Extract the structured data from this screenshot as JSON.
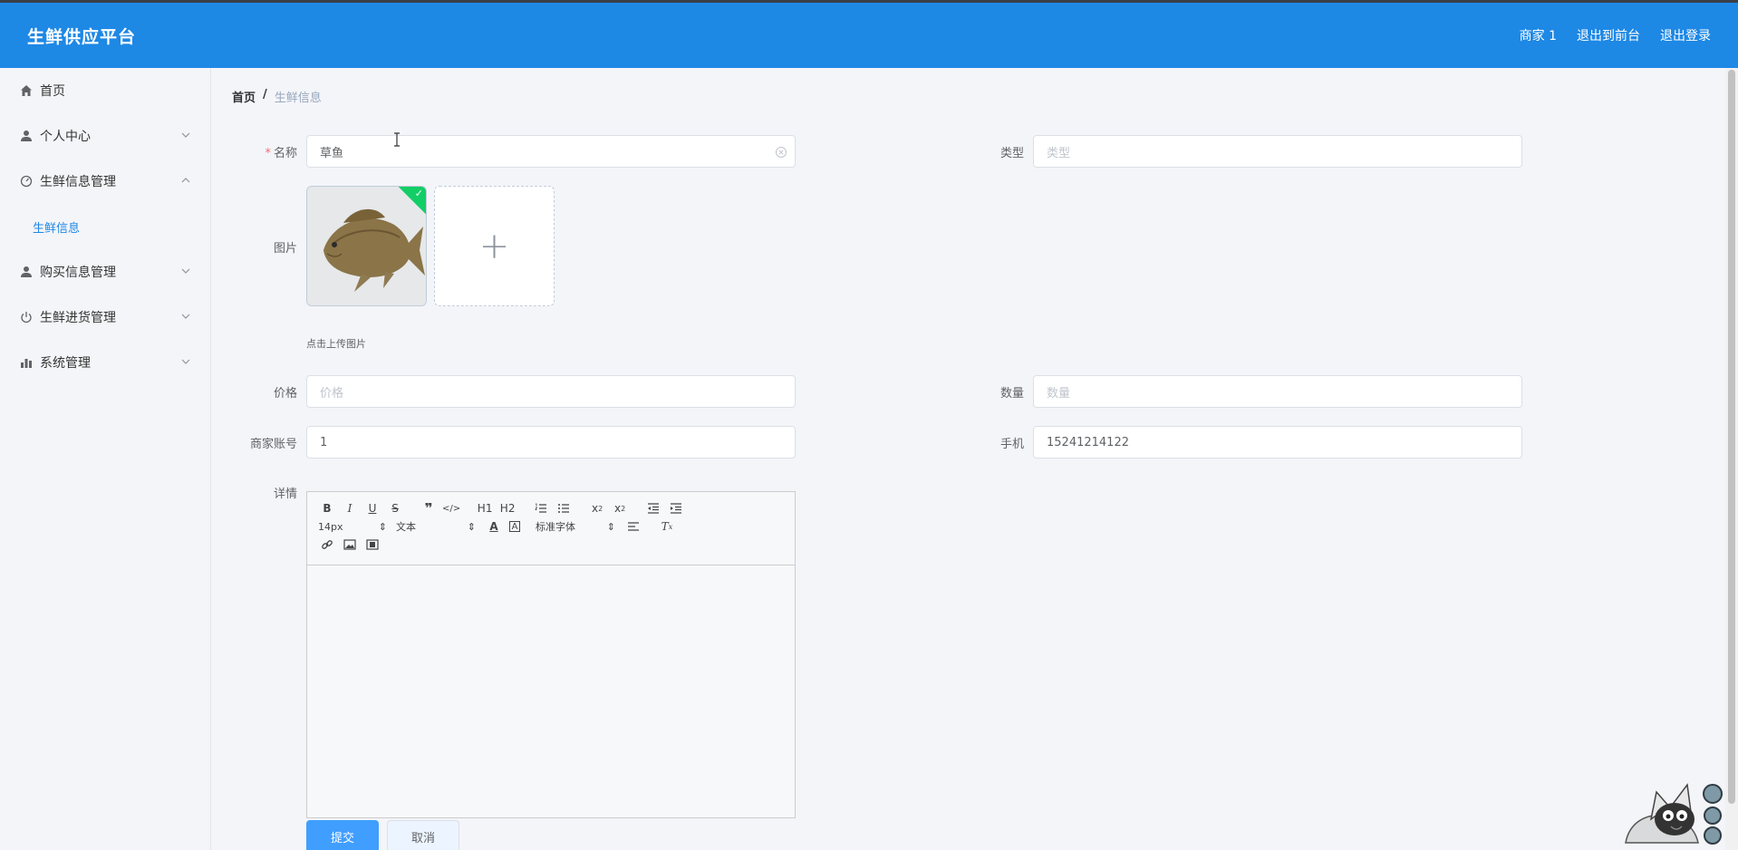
{
  "header": {
    "brand": "生鲜供应平台",
    "user": "商家 1",
    "back_to_front": "退出到前台",
    "logout": "退出登录"
  },
  "sidebar": {
    "items": [
      {
        "label": "首页",
        "icon": "home-icon"
      },
      {
        "label": "个人中心",
        "icon": "user-icon"
      },
      {
        "label": "生鲜信息管理",
        "icon": "dashboard-icon"
      },
      {
        "label": "生鲜信息",
        "icon": ""
      },
      {
        "label": "购买信息管理",
        "icon": "user-icon"
      },
      {
        "label": "生鲜进货管理",
        "icon": "power-icon"
      },
      {
        "label": "系统管理",
        "icon": "bar-chart-icon"
      }
    ]
  },
  "breadcrumb": {
    "home": "首页",
    "separator": "/",
    "current": "生鲜信息"
  },
  "form": {
    "name_label": "名称",
    "name_value": "草鱼",
    "type_label": "类型",
    "type_placeholder": "类型",
    "image_label": "图片",
    "upload_tip": "点击上传图片",
    "price_label": "价格",
    "price_placeholder": "价格",
    "quantity_label": "数量",
    "quantity_placeholder": "数量",
    "merchant_label": "商家账号",
    "merchant_value": "1",
    "phone_label": "手机",
    "phone_value": "15241214122",
    "detail_label": "详情",
    "submit": "提交",
    "cancel": "取消"
  },
  "editor": {
    "font_size": "14px",
    "heading": "文本",
    "font_family": "标准字体",
    "h1": "H1",
    "h2": "H2"
  },
  "colors": {
    "brand": "#1e88e5",
    "primary_button": "#409eff",
    "success": "#13ce66",
    "required": "#f56c6c"
  }
}
